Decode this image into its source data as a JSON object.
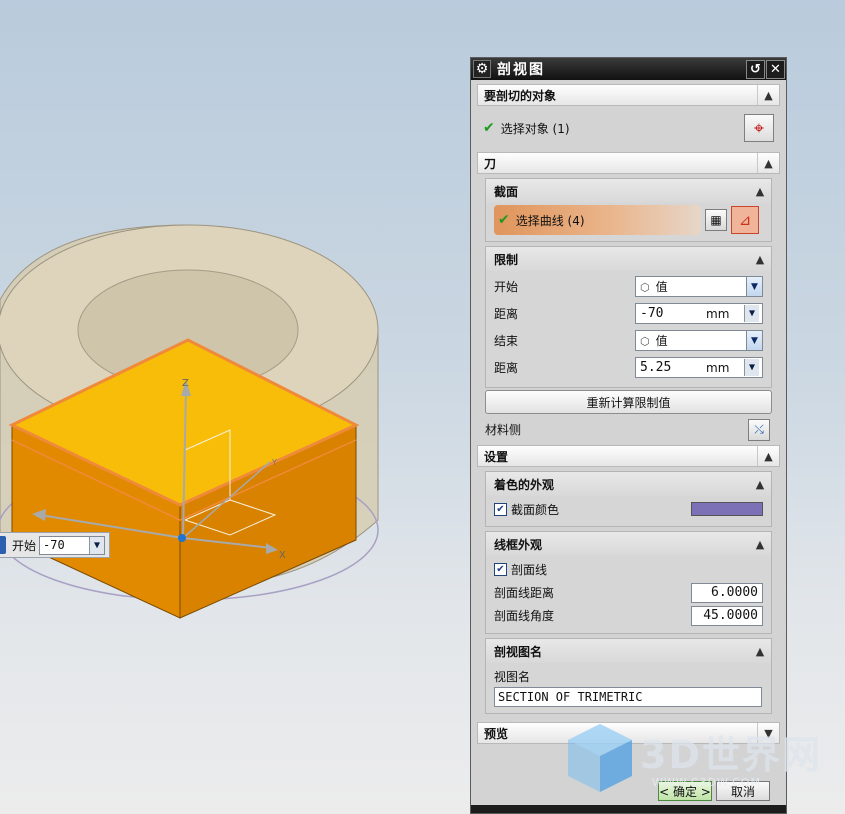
{
  "dialog": {
    "title": "剖视图",
    "object_group": {
      "header": "要剖切的对象",
      "select_label": "选择对象 (1)"
    },
    "knife_group": {
      "header": "刀",
      "section": {
        "header": "截面",
        "select_curve_label": "选择曲线 (4)"
      },
      "limits": {
        "header": "限制",
        "start_label": "开始",
        "start_value": "值",
        "start_distance_label": "距离",
        "start_distance_value": "-70",
        "start_distance_unit": "mm",
        "end_label": "结束",
        "end_value": "值",
        "end_distance_label": "距离",
        "end_distance_value": "5.25",
        "end_distance_unit": "mm"
      },
      "recalc_button": "重新计算限制值",
      "material_side_label": "材料侧"
    },
    "settings_group": {
      "header": "设置",
      "shaded": {
        "header": "着色的外观",
        "section_color_label": "截面颜色",
        "section_color": "#7c70b6"
      },
      "wireframe": {
        "header": "线框外观",
        "hatch_label": "剖面线",
        "hatch_distance_label": "剖面线距离",
        "hatch_distance_value": "6.0000",
        "hatch_angle_label": "剖面线角度",
        "hatch_angle_value": "45.0000"
      },
      "view_name": {
        "header": "剖视图名",
        "label": "视图名",
        "value": "SECTION OF TRIMETRIC"
      }
    },
    "preview_group": {
      "header": "预览"
    },
    "ok_label": "< 确定 >",
    "cancel_label": "取消"
  },
  "viewport": {
    "float_label": "开始",
    "float_value": "-70",
    "axis_z": "Z",
    "axis_x": "X",
    "axis_y": "Y"
  },
  "watermark": {
    "text": "3D世界网",
    "url": "WWW.C3DW.COM"
  },
  "colors": {
    "box_top": "#f5b800",
    "box_side": "#e08800",
    "ring": "#d2c9ae",
    "section_outline": "#ef8a3a"
  }
}
